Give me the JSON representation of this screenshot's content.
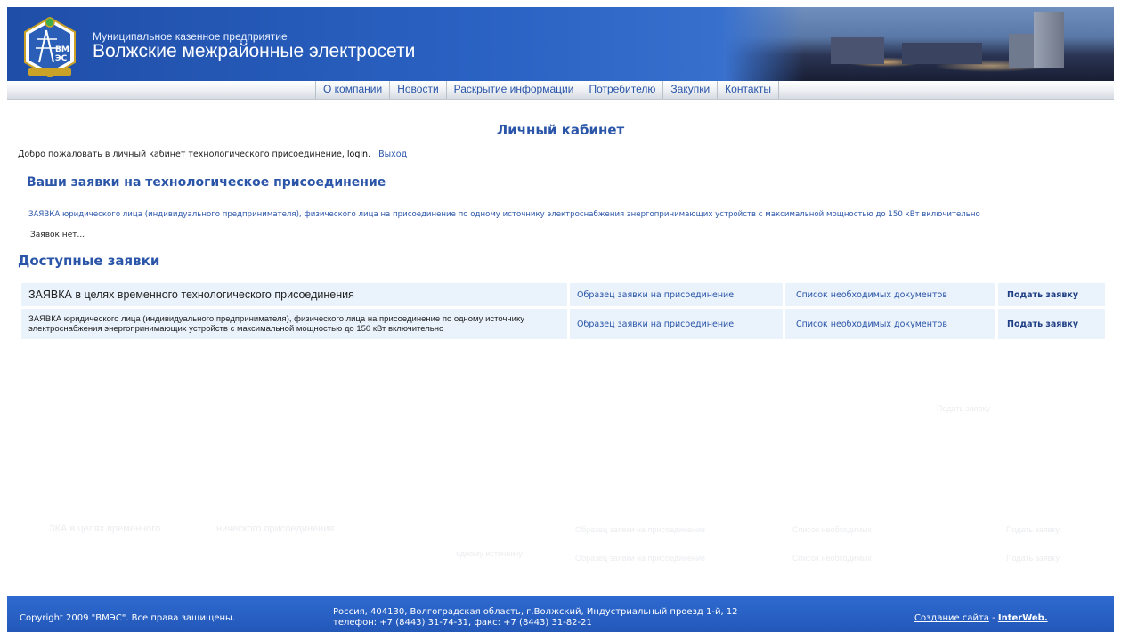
{
  "header": {
    "org_subtitle": "Муниципальное казенное предприятие",
    "org_name": "Волжские межрайонные электросети",
    "logo_text": "ВМЭС"
  },
  "nav": {
    "items": [
      {
        "label": "О компании"
      },
      {
        "label": "Новости"
      },
      {
        "label": "Раскрытие информации"
      },
      {
        "label": "Потребителю"
      },
      {
        "label": "Закупки"
      },
      {
        "label": "Контакты"
      }
    ]
  },
  "main": {
    "title": "Личный кабинет",
    "welcome_text": "Добро пожаловать в личный кабинет технологического присоединение,",
    "login": "login",
    "logout": "Выход",
    "my_requests_heading": "Ваши заявки на технологическое присоединение",
    "request_type_link": "ЗАЯВКА юридического лица (индивидуального предпринимателя), физического лица на присоединение по одному источнику электроснабжения энергопринимающих устройств с максимальной мощностью до 150 кВт включительно",
    "no_requests": "Заявок нет...",
    "available_heading": "Доступные заявки",
    "available": [
      {
        "name": "ЗАЯВКА в целях временного технологического присоединения",
        "sample": "Образец заявки на присоединение",
        "docs": "Список необходимых документов",
        "apply": "Подать заявку"
      },
      {
        "name": "ЗАЯВКА юридического лица (индивидуального предпринимателя), физического лица на присоединение по одному источнику электроснабжения энергопринимающих устройств с максимальной мощностью до 150 кВт включительно",
        "sample": "Образец заявки на присоединение",
        "docs": "Список необходимых документов",
        "apply": "Подать заявку"
      }
    ]
  },
  "ghost": {
    "g1": "Подать заявку",
    "g2": "ЗКА в целях временного",
    "g3": "нического присоединения",
    "g4": "Образец заявки на присоединение",
    "g5": "Список необходимых",
    "g6": "Подать заявку",
    "g7": "одному источнику",
    "g8": "Образец заявки на присоединение",
    "g9": "Список необходимых",
    "g10": "Подать заявку"
  },
  "footer": {
    "copyright": "Copyright 2009 \"ВМЭС\". Все права защищены.",
    "address_line1": "Россия, 404130, Волгоградская область, г.Волжский, Индустриальный проезд 1-й, 12",
    "address_line2": "телефон: +7 (8443) 31-74-31, факс: +7 (8443) 31-82-21",
    "site_credit": "Создание сайта",
    "dash": " - ",
    "developer": "InterWeb."
  },
  "colors": {
    "accent": "#2a55a8",
    "header_blue": "#1f4ea8",
    "footer_blue": "#2358b8",
    "row_bg": "#eaf2fb"
  }
}
